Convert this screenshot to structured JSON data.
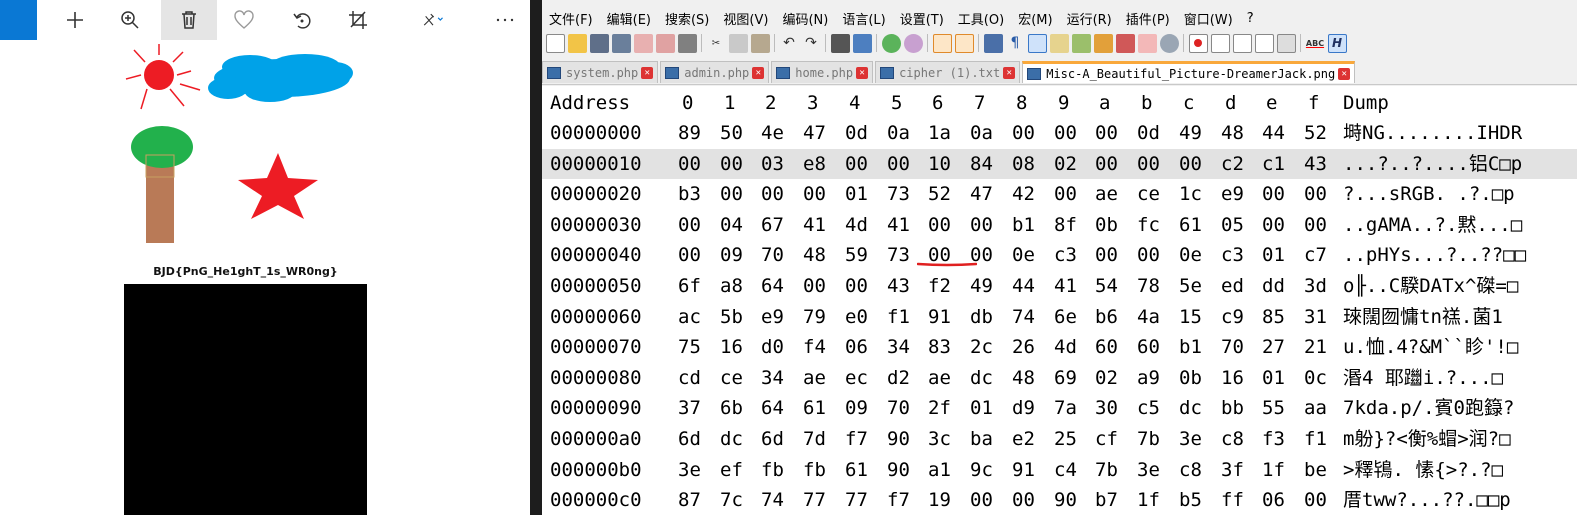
{
  "viewer": {
    "toolbar": [
      "add-icon",
      "zoom-in-icon",
      "delete-icon",
      "favorite-icon",
      "rotate-icon",
      "crop-icon",
      "edit-icon",
      "more-icon"
    ],
    "flag_text": "BJD{PnG_He1ghT_1s_WR0ng}"
  },
  "editor_app": {
    "menu": [
      "文件(F)",
      "编辑(E)",
      "搜索(S)",
      "视图(V)",
      "编码(N)",
      "语言(L)",
      "设置(T)",
      "工具(O)",
      "宏(M)",
      "运行(R)",
      "插件(P)",
      "窗口(W)",
      "?"
    ],
    "tabs": [
      {
        "label": "system.php",
        "active": false
      },
      {
        "label": "admin.php",
        "active": false
      },
      {
        "label": "home.php",
        "active": false
      },
      {
        "label": "cipher (1).txt",
        "active": false
      },
      {
        "label": "Misc-A_Beautiful_Picture-DreamerJack.png",
        "active": true
      }
    ],
    "hex_header": {
      "address": "Address",
      "columns": [
        "0",
        "1",
        "2",
        "3",
        "4",
        "5",
        "6",
        "7",
        "8",
        "9",
        "a",
        "b",
        "c",
        "d",
        "e",
        "f"
      ],
      "dump": "Dump"
    },
    "rows": [
      {
        "addr": "00000000",
        "bytes": [
          "89",
          "50",
          "4e",
          "47",
          "0d",
          "0a",
          "1a",
          "0a",
          "00",
          "00",
          "00",
          "0d",
          "49",
          "48",
          "44",
          "52"
        ],
        "dump": "塒NG........IHDR"
      },
      {
        "addr": "00000010",
        "bytes": [
          "00",
          "00",
          "03",
          "e8",
          "00",
          "00",
          "10",
          "84",
          "08",
          "02",
          "00",
          "00",
          "00",
          "c2",
          "c1",
          "43"
        ],
        "dump": "...?..?....铝C□p"
      },
      {
        "addr": "00000020",
        "bytes": [
          "b3",
          "00",
          "00",
          "00",
          "01",
          "73",
          "52",
          "47",
          "42",
          "00",
          "ae",
          "ce",
          "1c",
          "e9",
          "00",
          "00"
        ],
        "dump": "?...sRGB. .?.□p"
      },
      {
        "addr": "00000030",
        "bytes": [
          "00",
          "04",
          "67",
          "41",
          "4d",
          "41",
          "00",
          "00",
          "b1",
          "8f",
          "0b",
          "fc",
          "61",
          "05",
          "00",
          "00"
        ],
        "dump": "..gAMA..?.黙...□"
      },
      {
        "addr": "00000040",
        "bytes": [
          "00",
          "09",
          "70",
          "48",
          "59",
          "73",
          "00",
          "00",
          "0e",
          "c3",
          "00",
          "00",
          "0e",
          "c3",
          "01",
          "c7"
        ],
        "dump": "..pHYs...?..??□□"
      },
      {
        "addr": "00000050",
        "bytes": [
          "6f",
          "a8",
          "64",
          "00",
          "00",
          "43",
          "f2",
          "49",
          "44",
          "41",
          "54",
          "78",
          "5e",
          "ed",
          "dd",
          "3d"
        ],
        "dump": "o╟..C騤DATx^磔=□"
      },
      {
        "addr": "00000060",
        "bytes": [
          "ac",
          "5b",
          "e9",
          "79",
          "e0",
          "f1",
          "91",
          "db",
          "74",
          "6e",
          "b6",
          "4a",
          "15",
          "c9",
          "85",
          "31"
        ],
        "dump": "琜闊囫慵tn禚.菌1"
      },
      {
        "addr": "00000070",
        "bytes": [
          "75",
          "16",
          "d0",
          "f4",
          "06",
          "34",
          "83",
          "2c",
          "26",
          "4d",
          "60",
          "60",
          "b1",
          "70",
          "27",
          "21"
        ],
        "dump": "u.恤.4?&M``眕'!□"
      },
      {
        "addr": "00000080",
        "bytes": [
          "cd",
          "ce",
          "34",
          "ae",
          "ec",
          "d2",
          "ae",
          "dc",
          "48",
          "69",
          "02",
          "a9",
          "0b",
          "16",
          "01",
          "0c"
        ],
        "dump": "湣4 耶躖i.?...□"
      },
      {
        "addr": "00000090",
        "bytes": [
          "37",
          "6b",
          "64",
          "61",
          "09",
          "70",
          "2f",
          "01",
          "d9",
          "7a",
          "30",
          "c5",
          "dc",
          "bb",
          "55",
          "aa"
        ],
        "dump": "7kda.p/.賓0跑籙?"
      },
      {
        "addr": "000000a0",
        "bytes": [
          "6d",
          "dc",
          "6d",
          "7d",
          "f7",
          "90",
          "3c",
          "ba",
          "e2",
          "25",
          "cf",
          "7b",
          "3e",
          "c8",
          "f3",
          "f1"
        ],
        "dump": "m躮}?<衡%蝐>润?□"
      },
      {
        "addr": "000000b0",
        "bytes": [
          "3e",
          "ef",
          "fb",
          "fb",
          "61",
          "90",
          "a1",
          "9c",
          "91",
          "c4",
          "7b",
          "3e",
          "c8",
          "3f",
          "1f",
          "be"
        ],
        "dump": ">釋鴇. 愫{>?.?□"
      },
      {
        "addr": "000000c0",
        "bytes": [
          "87",
          "7c",
          "74",
          "77",
          "77",
          "f7",
          "19",
          "00",
          "00",
          "90",
          "b7",
          "1f",
          "b5",
          "ff",
          "06",
          "00"
        ],
        "dump": "厝tww?...??.□□p"
      }
    ],
    "selected_row": 1
  },
  "colors": {
    "accent_blue": "#0a78d4",
    "red_mark": "#e02020",
    "sun": "#ed1c24",
    "cloud": "#00a2e8",
    "tree_top": "#22b14c",
    "trunk": "#b97a57",
    "star": "#ed1c24"
  }
}
